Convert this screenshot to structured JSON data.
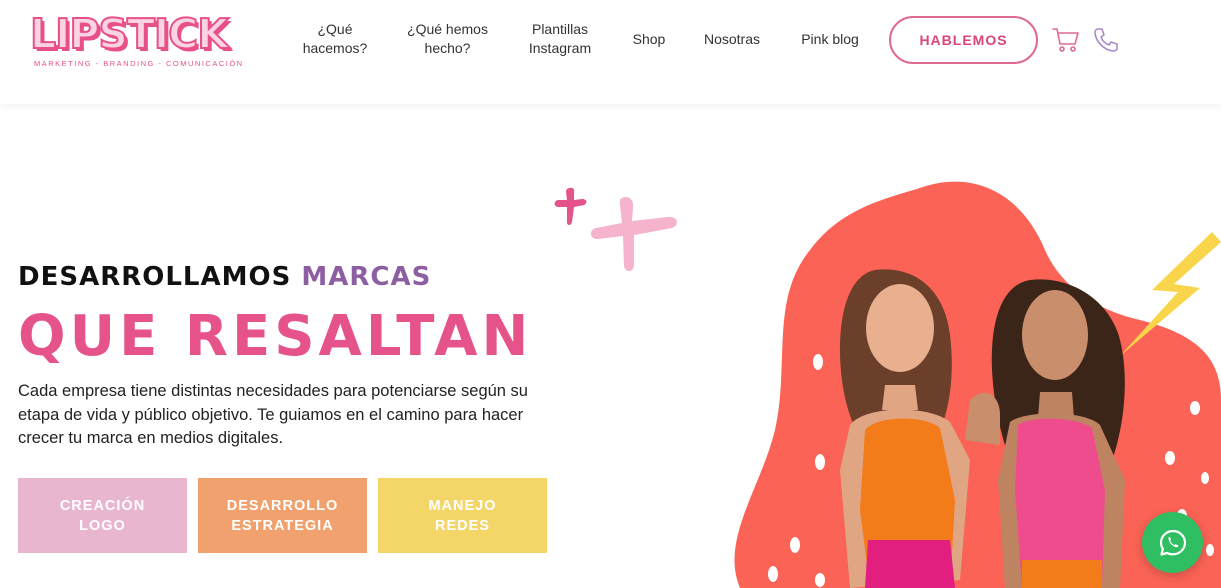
{
  "header": {
    "logo": {
      "word": "LIPSTICK",
      "tagline": "MARKETING - BRANDING - COMUNICACIÓN"
    },
    "nav": [
      {
        "label_line1": "¿Qué",
        "label_line2": "hacemos?"
      },
      {
        "label_line1": "¿Qué hemos",
        "label_line2": "hecho?"
      },
      {
        "label_line1": "Plantillas",
        "label_line2": "Instagram"
      },
      {
        "label_line1": "Shop",
        "label_line2": ""
      },
      {
        "label_line1": "Nosotras",
        "label_line2": ""
      },
      {
        "label_line1": "Pink blog",
        "label_line2": ""
      }
    ],
    "cta_label": "HABLEMOS",
    "icons": [
      "cart-icon",
      "phone-icon"
    ]
  },
  "hero": {
    "headline_part1": "DESARROLLAMOS",
    "headline_accent": "MARCAS",
    "headline_big": "QUE RESALTAN",
    "description": "Cada empresa tiene distintas necesidades para potenciarse según su etapa de vida y público objetivo. Te guiamos en el camino para hacer crecer tu marca en medios digitales.",
    "services": [
      {
        "line1": "CREACIÓN",
        "line2": "LOGO",
        "color": "#e9b6cf"
      },
      {
        "line1": "DESARROLLO",
        "line2": "ESTRATEGIA",
        "color": "#f1a16e"
      },
      {
        "line1": "MANEJO",
        "line2": "REDES",
        "color": "#f4d668"
      }
    ]
  },
  "colors": {
    "brand_pink": "#e6538a",
    "accent_purple": "#8e5ea2",
    "blob_coral": "#fb6356",
    "lightning_yellow": "#f8d54a",
    "whatsapp_green": "#2fbf62"
  },
  "floating": {
    "whatsapp_icon": "whatsapp-icon"
  }
}
